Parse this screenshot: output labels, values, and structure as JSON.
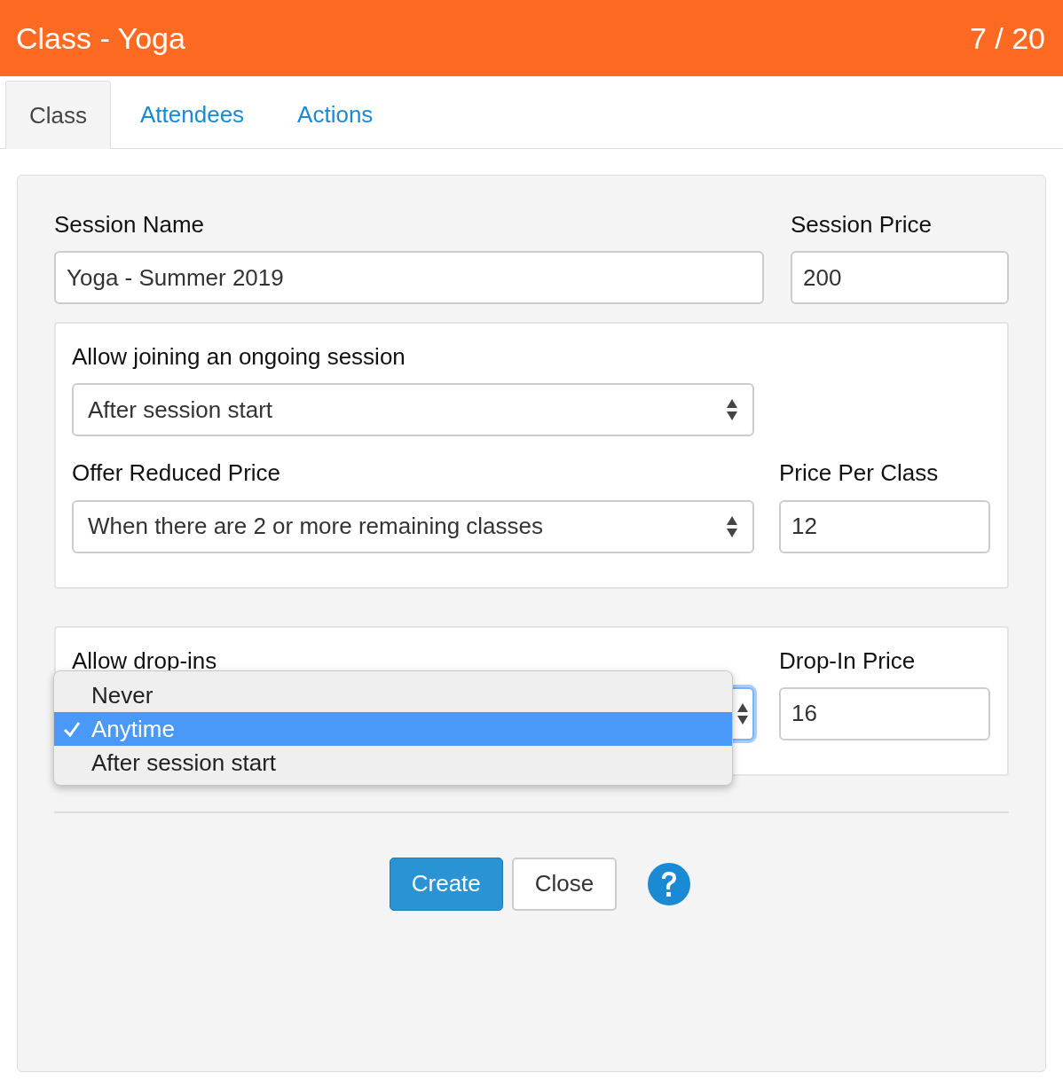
{
  "header": {
    "title": "Class - Yoga",
    "counter": "7 / 20"
  },
  "tabs": [
    {
      "label": "Class",
      "selected": true
    },
    {
      "label": "Attendees",
      "selected": false
    },
    {
      "label": "Actions",
      "selected": false
    }
  ],
  "session_name": {
    "label": "Session Name",
    "value": "Yoga - Summer 2019"
  },
  "session_price": {
    "label": "Session Price",
    "value": "200"
  },
  "joining": {
    "label": "Allow joining an ongoing session",
    "value": "After session start"
  },
  "reduced_price": {
    "label": "Offer Reduced Price",
    "value": "When there are 2 or more remaining classes"
  },
  "price_per_class": {
    "label": "Price Per Class",
    "value": "12"
  },
  "drop_ins": {
    "label": "Allow drop-ins",
    "expanded": true,
    "options": [
      {
        "label": "Never",
        "selected": false
      },
      {
        "label": "Anytime",
        "selected": true
      },
      {
        "label": "After session start",
        "selected": false
      }
    ]
  },
  "drop_in_price": {
    "label": "Drop-In Price",
    "value": "16"
  },
  "buttons": [
    {
      "label": "Create",
      "kind": "primary"
    },
    {
      "label": "Close",
      "kind": "secondary"
    }
  ]
}
